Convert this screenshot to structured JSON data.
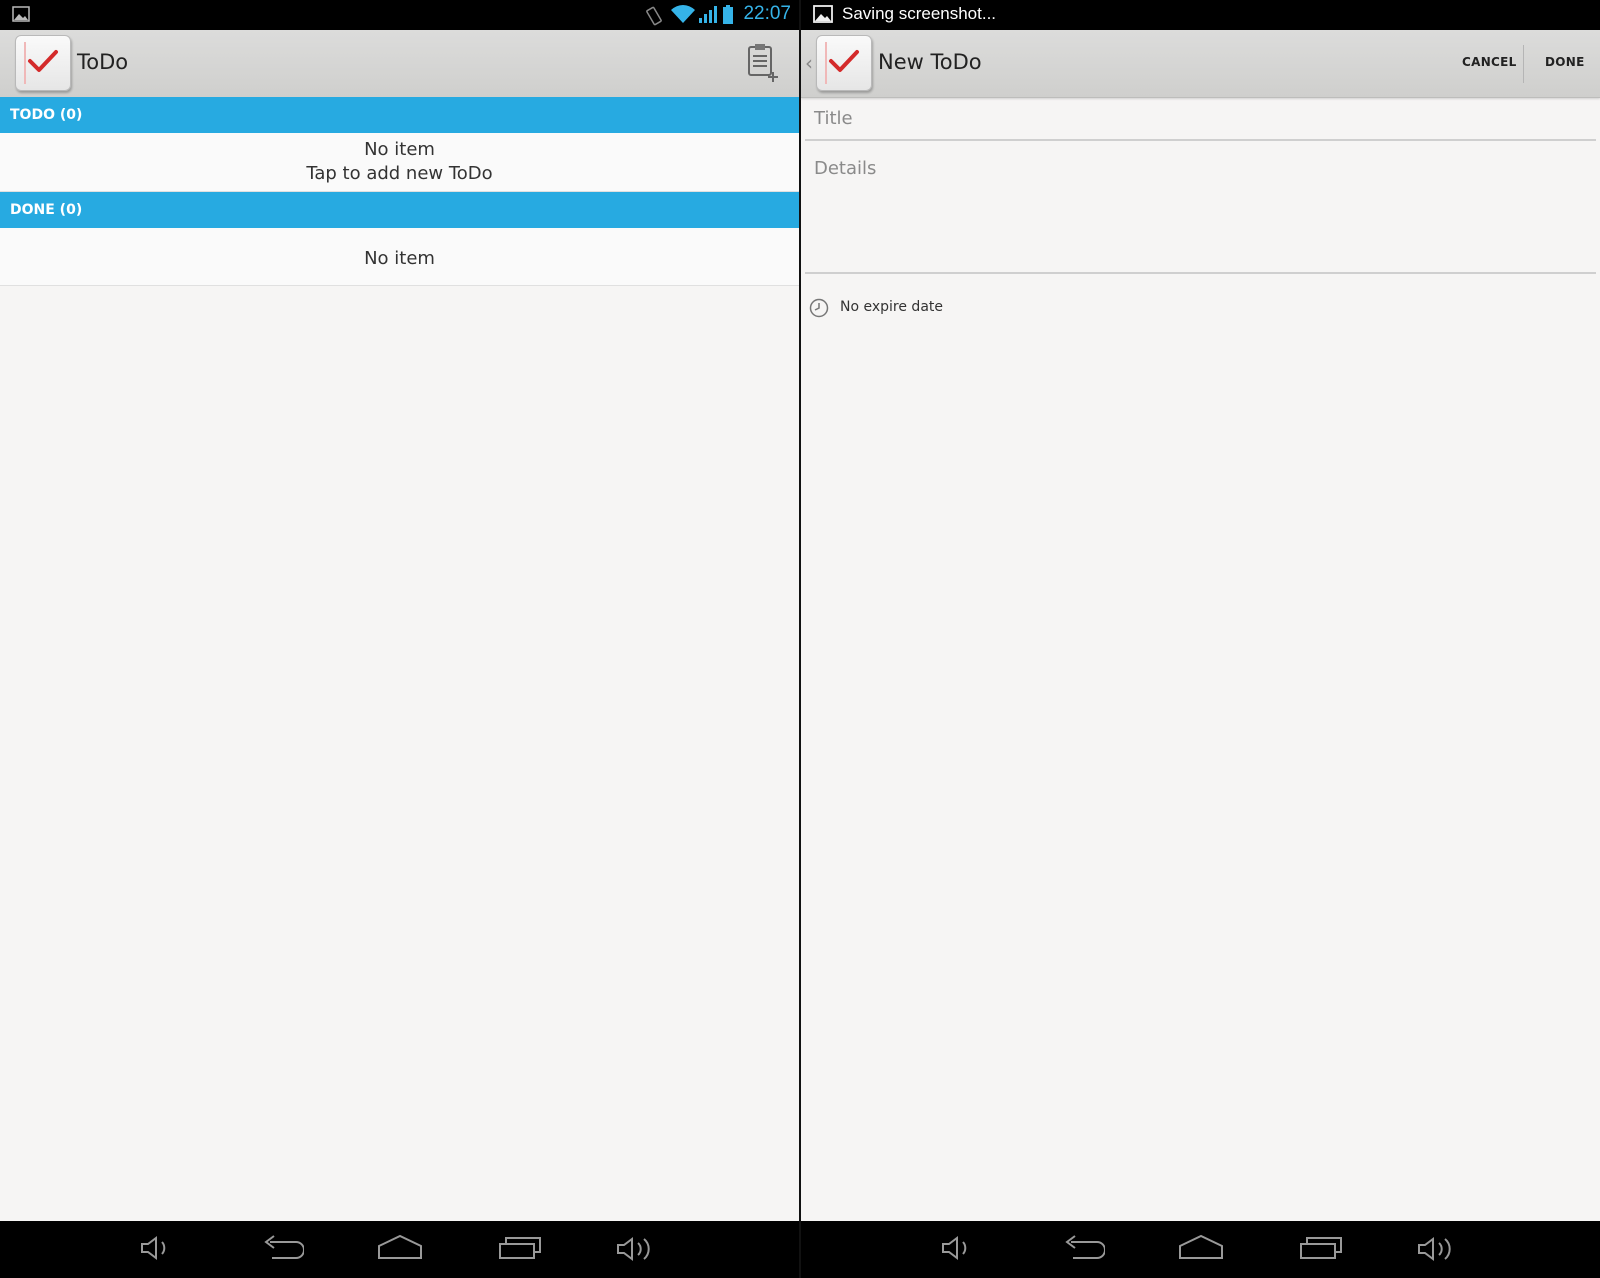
{
  "left": {
    "status_bar": {
      "time": "22:07"
    },
    "action_bar": {
      "title": "ToDo",
      "add_icon": "clipboard-add-icon"
    },
    "todo_section": {
      "header": "TODO (0)",
      "empty_line1": "No item",
      "empty_line2": "Tap to add new ToDo"
    },
    "done_section": {
      "header": "DONE (0)",
      "empty_line1": "No item"
    }
  },
  "right": {
    "status_bar": {
      "notification": "Saving screenshot..."
    },
    "action_bar": {
      "title": "New ToDo",
      "cancel_label": "CANCEL",
      "done_label": "DONE"
    },
    "form": {
      "title_placeholder": "Title",
      "details_placeholder": "Details",
      "expire_label": "No expire date"
    }
  },
  "colors": {
    "accent": "#27aae1",
    "check": "#d42a2a",
    "status_time": "#35b3e8"
  }
}
